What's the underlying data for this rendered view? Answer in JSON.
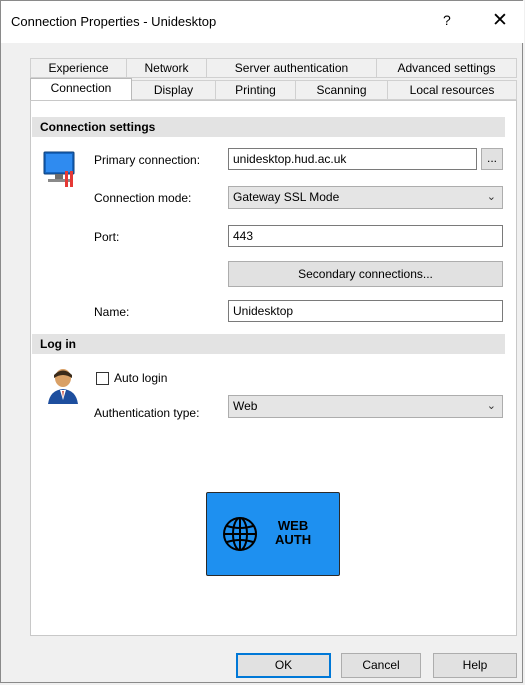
{
  "window": {
    "title": "Connection Properties - Unidesktop",
    "help_glyph": "?",
    "close_glyph": "✕"
  },
  "tabs": {
    "row1": [
      "Experience",
      "Network",
      "Server authentication",
      "Advanced settings"
    ],
    "row2": [
      "Connection",
      "Display",
      "Printing",
      "Scanning",
      "Local resources"
    ],
    "active": "Connection"
  },
  "connection_settings": {
    "header": "Connection settings",
    "icon": "monitor-connection-icon",
    "primary_label": "Primary connection:",
    "primary_value": "unidesktop.hud.ac.uk",
    "browse_label": "...",
    "mode_label": "Connection mode:",
    "mode_value": "Gateway SSL Mode",
    "port_label": "Port:",
    "port_value": "443",
    "secondary_button": "Secondary connections...",
    "name_label": "Name:",
    "name_value": "Unidesktop"
  },
  "login": {
    "header": "Log in",
    "icon": "user-icon",
    "auto_login_label": "Auto login",
    "auto_login_checked": false,
    "auth_type_label": "Authentication type:",
    "auth_type_value": "Web",
    "webauth_line1": "WEB",
    "webauth_line2": "AUTH",
    "webauth_icon": "globe-icon",
    "webauth_color": "#1e90f0"
  },
  "footer": {
    "ok": "OK",
    "cancel": "Cancel",
    "help": "Help"
  }
}
